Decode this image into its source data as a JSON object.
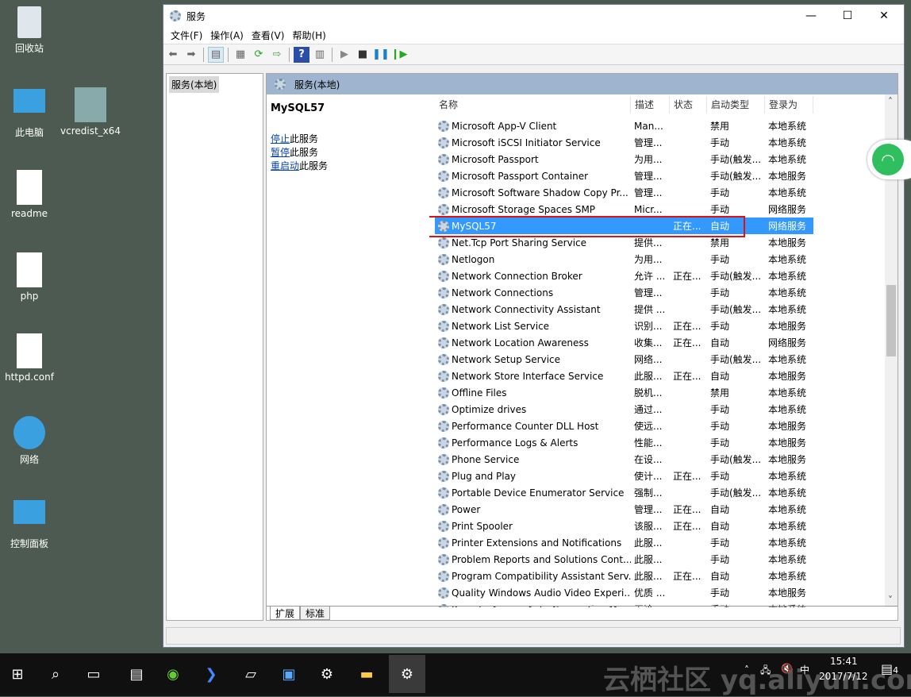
{
  "desktop": {
    "icons": [
      "回收站",
      "此电脑",
      "vcredist_x64",
      "readme",
      "php",
      "httpd.conf",
      "网络",
      "控制面板"
    ]
  },
  "window": {
    "title": "服务",
    "minimize": "—",
    "maximize": "☐",
    "close": "✕"
  },
  "menu": [
    "文件(F)",
    "操作(A)",
    "查看(V)",
    "帮助(H)"
  ],
  "tree": {
    "node": "服务(本地)"
  },
  "pane": {
    "header": "服务(本地)",
    "selected_service": "MySQL57",
    "actions": [
      {
        "link": "停止",
        "rest": "此服务"
      },
      {
        "link": "暂停",
        "rest": "此服务"
      },
      {
        "link": "重启动",
        "rest": "此服务"
      }
    ]
  },
  "columns": [
    "名称",
    "描述",
    "状态",
    "启动类型",
    "登录为"
  ],
  "rows": [
    [
      "Microsoft App-V Client",
      "Man...",
      "",
      "禁用",
      "本地系统"
    ],
    [
      "Microsoft iSCSI Initiator Service",
      "管理...",
      "",
      "手动",
      "本地系统"
    ],
    [
      "Microsoft Passport",
      "为用...",
      "",
      "手动(触发...",
      "本地系统"
    ],
    [
      "Microsoft Passport Container",
      "管理...",
      "",
      "手动(触发...",
      "本地服务"
    ],
    [
      "Microsoft Software Shadow Copy Pr...",
      "管理...",
      "",
      "手动",
      "本地系统"
    ],
    [
      "Microsoft Storage Spaces SMP",
      "Micr...",
      "",
      "手动",
      "网络服务"
    ],
    [
      "MySQL57",
      "",
      "正在...",
      "自动",
      "网络服务"
    ],
    [
      "Net.Tcp Port Sharing Service",
      "提供...",
      "",
      "禁用",
      "本地服务"
    ],
    [
      "Netlogon",
      "为用...",
      "",
      "手动",
      "本地系统"
    ],
    [
      "Network Connection Broker",
      "允许 ...",
      "正在...",
      "手动(触发...",
      "本地系统"
    ],
    [
      "Network Connections",
      "管理...",
      "",
      "手动",
      "本地系统"
    ],
    [
      "Network Connectivity Assistant",
      "提供 ...",
      "",
      "手动(触发...",
      "本地系统"
    ],
    [
      "Network List Service",
      "识别...",
      "正在...",
      "手动",
      "本地服务"
    ],
    [
      "Network Location Awareness",
      "收集...",
      "正在...",
      "自动",
      "网络服务"
    ],
    [
      "Network Setup Service",
      "网络...",
      "",
      "手动(触发...",
      "本地系统"
    ],
    [
      "Network Store Interface Service",
      "此服...",
      "正在...",
      "自动",
      "本地服务"
    ],
    [
      "Offline Files",
      "脱机...",
      "",
      "禁用",
      "本地系统"
    ],
    [
      "Optimize drives",
      "通过...",
      "",
      "手动",
      "本地系统"
    ],
    [
      "Performance Counter DLL Host",
      "使远...",
      "",
      "手动",
      "本地服务"
    ],
    [
      "Performance Logs & Alerts",
      "性能...",
      "",
      "手动",
      "本地服务"
    ],
    [
      "Phone Service",
      "在设...",
      "",
      "手动(触发...",
      "本地服务"
    ],
    [
      "Plug and Play",
      "使计...",
      "正在...",
      "手动",
      "本地系统"
    ],
    [
      "Portable Device Enumerator Service",
      "强制...",
      "",
      "手动(触发...",
      "本地系统"
    ],
    [
      "Power",
      "管理...",
      "正在...",
      "自动",
      "本地系统"
    ],
    [
      "Print Spooler",
      "该服...",
      "正在...",
      "自动",
      "本地系统"
    ],
    [
      "Printer Extensions and Notifications",
      "此服...",
      "",
      "手动",
      "本地系统"
    ],
    [
      "Problem Reports and Solutions Cont...",
      "此服...",
      "",
      "手动",
      "本地系统"
    ],
    [
      "Program Compatibility Assistant Serv...",
      "此服...",
      "正在...",
      "自动",
      "本地系统"
    ],
    [
      "Quality Windows Audio Video Experi...",
      "优质 ...",
      "",
      "手动",
      "本地服务"
    ],
    [
      "Remote Access Auto Connection Ma...",
      "无论...",
      "",
      "手动",
      "本地系统"
    ]
  ],
  "selected_index": 6,
  "tabs": [
    "扩展",
    "标准"
  ],
  "taskbar": {
    "time": "15:41",
    "date": "2017/7/12",
    "ime": "中",
    "notifications": "4",
    "watermark": "云栖社区 yq.aliyun.com"
  }
}
